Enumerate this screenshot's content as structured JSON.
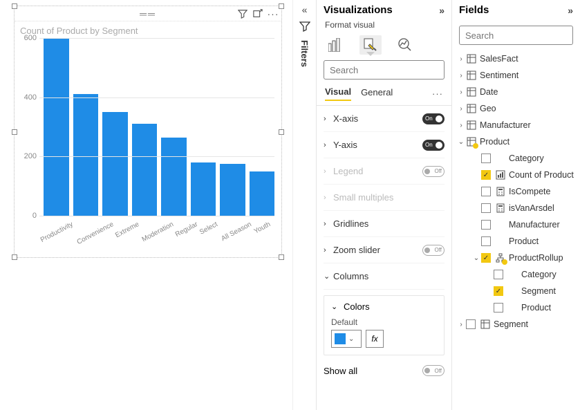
{
  "chart_data": {
    "type": "bar",
    "title": "Count of Product by Segment",
    "categories": [
      "Productivity",
      "Convenience",
      "Extreme",
      "Moderation",
      "Regular",
      "Select",
      "All Season",
      "Youth"
    ],
    "values": [
      600,
      410,
      350,
      310,
      265,
      180,
      175,
      150
    ],
    "xlabel": "",
    "ylabel": "",
    "ylim": [
      0,
      600
    ],
    "yticks": [
      0,
      200,
      400,
      600
    ],
    "bar_color": "#1f8ce6"
  },
  "filters": {
    "label": "Filters"
  },
  "viz": {
    "title": "Visualizations",
    "sub": "Format visual",
    "search_ph": "Search",
    "tabs": {
      "visual": "Visual",
      "general": "General"
    },
    "props": {
      "xaxis": {
        "label": "X-axis",
        "state": "on",
        "enabled": true,
        "toggle": true
      },
      "yaxis": {
        "label": "Y-axis",
        "state": "on",
        "enabled": true,
        "toggle": true
      },
      "legend": {
        "label": "Legend",
        "state": "off",
        "enabled": false,
        "toggle": true
      },
      "smallm": {
        "label": "Small multiples",
        "state": "",
        "enabled": false,
        "toggle": false
      },
      "grid": {
        "label": "Gridlines",
        "state": "",
        "enabled": true,
        "toggle": false
      },
      "zoom": {
        "label": "Zoom slider",
        "state": "off",
        "enabled": true,
        "toggle": true
      },
      "columns": {
        "label": "Columns",
        "state": "",
        "enabled": true,
        "toggle": false
      }
    },
    "colors": {
      "card_title": "Colors",
      "default_label": "Default",
      "fx": "fx",
      "swatch": "#1f8ce6",
      "show_all": "Show all",
      "show_all_state": "off"
    },
    "toggle_text": {
      "on": "On",
      "off": "Off"
    }
  },
  "fields": {
    "title": "Fields",
    "search_ph": "Search",
    "tables": [
      {
        "name": "SalesFact",
        "expanded": false
      },
      {
        "name": "Sentiment",
        "expanded": false
      },
      {
        "name": "Date",
        "expanded": false
      },
      {
        "name": "Geo",
        "expanded": false
      },
      {
        "name": "Manufacturer",
        "expanded": false
      },
      {
        "name": "Product",
        "expanded": true,
        "highlight": true,
        "fields": [
          {
            "name": "Category",
            "checked": false,
            "icon": ""
          },
          {
            "name": "Count of Product",
            "checked": true,
            "icon": "measure"
          },
          {
            "name": "IsCompete",
            "checked": false,
            "icon": "calc"
          },
          {
            "name": "isVanArsdel",
            "checked": false,
            "icon": "calc"
          },
          {
            "name": "Manufacturer",
            "checked": false,
            "icon": ""
          },
          {
            "name": "Product",
            "checked": false,
            "icon": ""
          },
          {
            "name": "ProductRollup",
            "checked": true,
            "icon": "hierarchy",
            "expanded": true,
            "highlight": true,
            "children": [
              {
                "name": "Category",
                "checked": false
              },
              {
                "name": "Segment",
                "checked": true
              },
              {
                "name": "Product",
                "checked": false
              }
            ]
          }
        ]
      },
      {
        "name": "Segment",
        "expanded": false,
        "checkbox": true
      }
    ]
  }
}
